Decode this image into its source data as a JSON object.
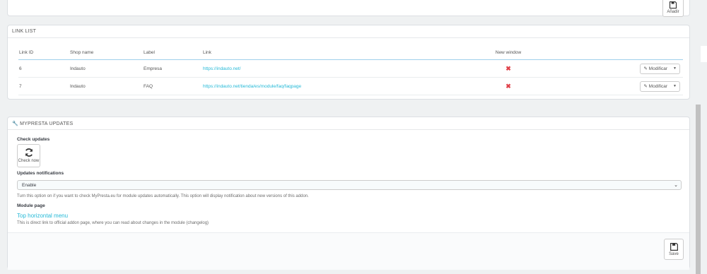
{
  "top_panel": {
    "add_label": "Añadir"
  },
  "link_list": {
    "title": "LINK LIST",
    "columns": [
      "Link ID",
      "Shop name",
      "Label",
      "Link",
      "New window",
      ""
    ],
    "rows": [
      {
        "id": "6",
        "shop": "Indauto",
        "label": "Empresa",
        "link": "https://indauto.net/",
        "new_window": "✖",
        "action": "Modificar"
      },
      {
        "id": "7",
        "shop": "Indauto",
        "label": "FAQ",
        "link": "https://indauto.net/tienda/es/module/faq/faqpage",
        "new_window": "✖",
        "action": "Modificar"
      }
    ]
  },
  "updates": {
    "title": "MYPRESTA UPDATES",
    "check_label": "Check updates",
    "check_button": "Check now",
    "notifications_label": "Updates notifications",
    "notifications_value": "Enable",
    "notifications_help": "Turn this option on if you want to check MyPresta.eu for module updates automatically. This option will display notification about new versions of this addon.",
    "module_page_label": "Module page",
    "module_link": "Top horizontal menu",
    "module_help": "This is direct link to official addon page, where you can read about changes in the module (changelog)",
    "save_label": "Save"
  },
  "colors": {
    "accent": "#25b9d7",
    "danger": "#e0414a",
    "background": "#eff1f2"
  }
}
